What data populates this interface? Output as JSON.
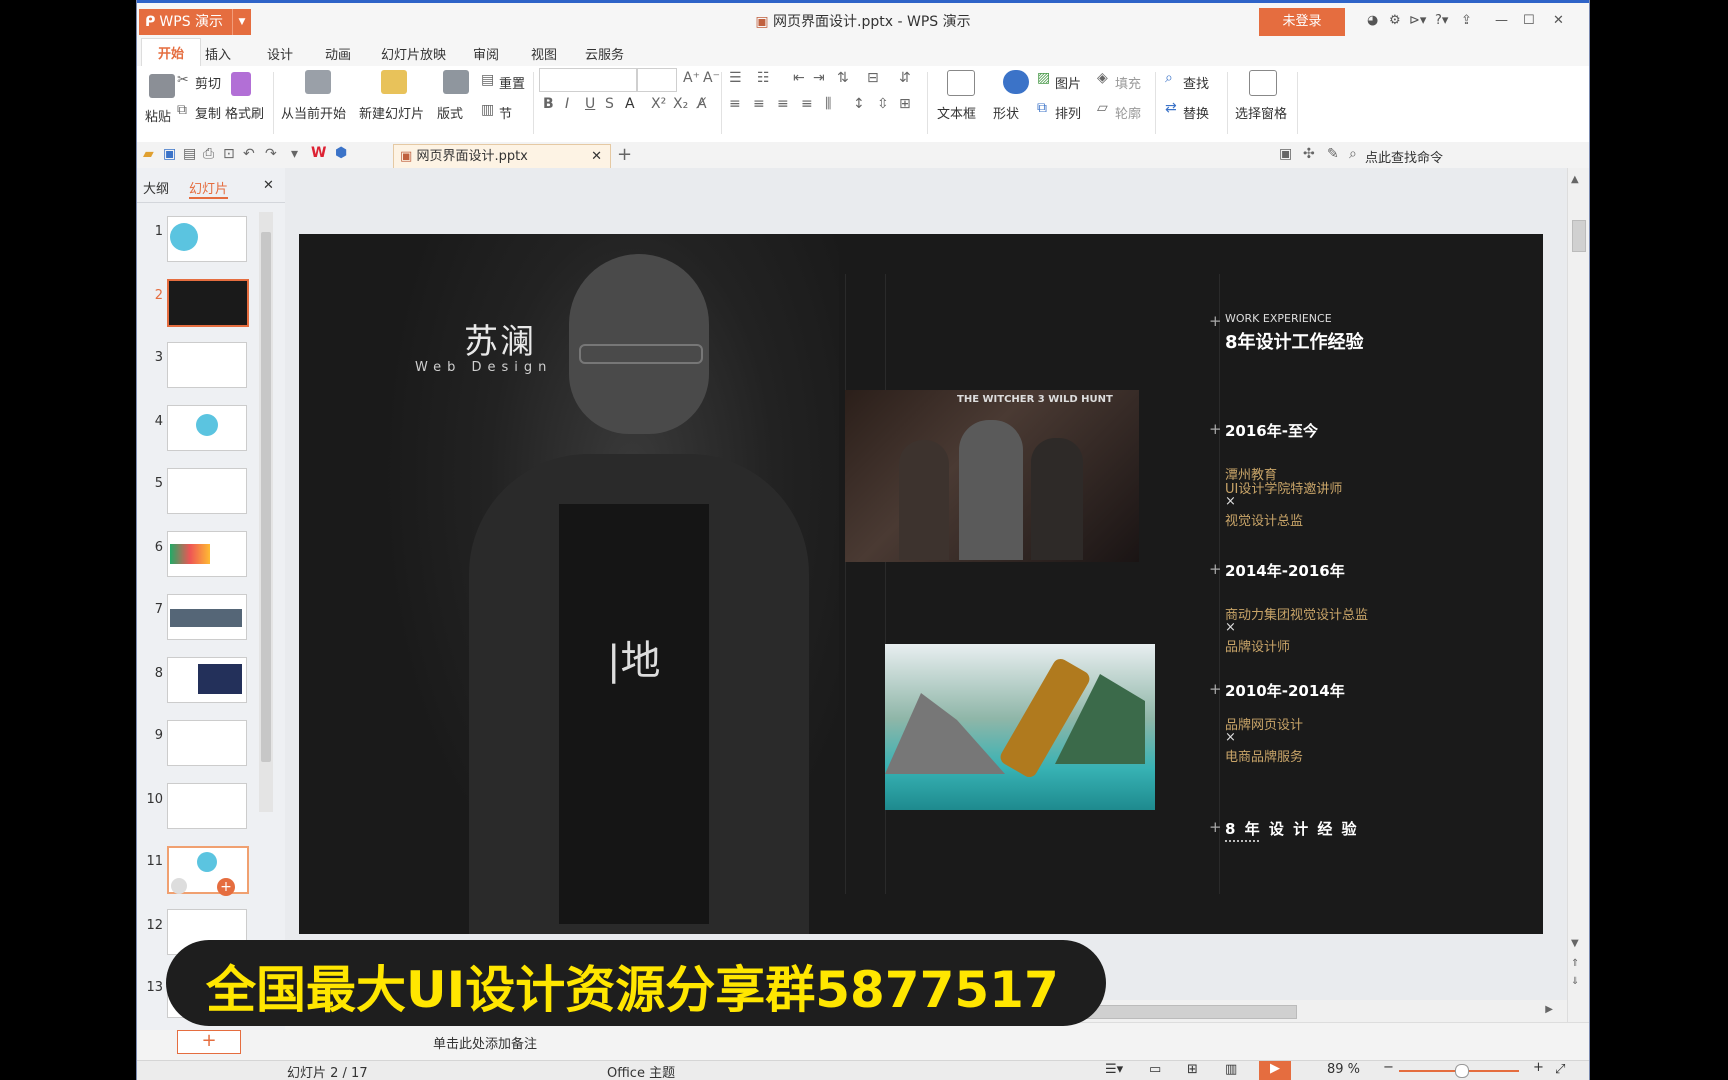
{
  "app": {
    "app_button": "WPS 演示",
    "window_title": "网页界面设计.pptx - WPS 演示",
    "login_label": "未登录"
  },
  "menu_tabs": [
    "开始",
    "插入",
    "设计",
    "动画",
    "幻灯片放映",
    "审阅",
    "视图",
    "云服务"
  ],
  "ribbon": {
    "paste": "粘贴",
    "cut": "剪切",
    "copy": "复制",
    "format_painter": "格式刷",
    "from_current": "从当前开始",
    "new_slide": "新建幻灯片",
    "layout": "版式",
    "reset": "重置",
    "section": "节",
    "text_box": "文本框",
    "shape": "形状",
    "picture": "图片",
    "fill": "填充",
    "arrange": "排列",
    "outline": "轮廓",
    "find": "查找",
    "replace": "替换",
    "selection_pane": "选择窗格"
  },
  "doc_tab": "网页界面设计.pptx",
  "search_command": "点此查找命令",
  "left_panel": {
    "tab_outline": "大纲",
    "tab_slides": "幻灯片",
    "slide_numbers": [
      "1",
      "2",
      "3",
      "4",
      "5",
      "6",
      "7",
      "8",
      "9",
      "10",
      "11",
      "12",
      "13"
    ],
    "selected_slide": 2
  },
  "slide": {
    "name": "苏澜",
    "subtitle": "Web Design",
    "section_en": "WORK EXPERIENCE",
    "section_cn": "8年设计工作经验",
    "entries": [
      {
        "year": "2016年-至今",
        "lines": [
          "潭州教育",
          "UI设计学院特邀讲师",
          "×",
          "视觉设计总监"
        ]
      },
      {
        "year": "2014年-2016年",
        "lines": [
          "商动力集团视觉设计总监",
          "×",
          "品牌设计师"
        ]
      },
      {
        "year": "2010年-2014年",
        "lines": [
          "品牌网页设计",
          "×",
          "电商品牌服务"
        ]
      }
    ],
    "footer": "8 年 设 计 经 验",
    "witcher_logo": "THE WITCHER 3 WILD HUNT"
  },
  "notes_placeholder": "单击此处添加备注",
  "status": {
    "slide_counter": "幻灯片 2 / 17",
    "theme": "Office 主题",
    "zoom": "89 %"
  },
  "overlay_banner": "全国最大UI设计资源分享群5877517",
  "colors": {
    "accent": "#e56d3f",
    "titlebar_border": "#2e63c8",
    "banner_text": "#ffe600"
  }
}
